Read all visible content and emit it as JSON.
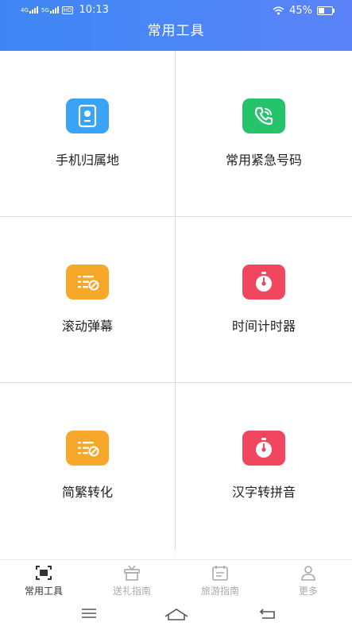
{
  "status_bar": {
    "network_1": "4G",
    "network_2": "5G",
    "hd_badge": "HD",
    "time": "10:13",
    "wifi_icon": "wifi-icon",
    "battery_percent": "45%",
    "battery_level": 0.45
  },
  "header": {
    "title": "常用工具"
  },
  "tools": [
    {
      "label": "手机归属地",
      "icon": "phone-location-icon",
      "color": "#3aa3f5"
    },
    {
      "label": "常用紧急号码",
      "icon": "phone-call-icon",
      "color": "#25c46a"
    },
    {
      "label": "滚动弹幕",
      "icon": "barrage-icon",
      "color": "#f7a72a"
    },
    {
      "label": "时间计时器",
      "icon": "stopwatch-icon",
      "color": "#f0475e"
    },
    {
      "label": "简繁转化",
      "icon": "convert-icon",
      "color": "#f7a72a"
    },
    {
      "label": "汉字转拼音",
      "icon": "stopwatch-icon",
      "color": "#f0475e"
    }
  ],
  "tabbar": {
    "items": [
      {
        "label": "常用工具",
        "icon": "tools-scan-icon",
        "active": true
      },
      {
        "label": "送礼指南",
        "icon": "gift-icon",
        "active": false
      },
      {
        "label": "旅游指南",
        "icon": "calendar-icon",
        "active": false
      },
      {
        "label": "更多",
        "icon": "person-icon",
        "active": false
      }
    ]
  },
  "system_nav": {
    "menu_icon": "menu-icon",
    "home_icon": "home-icon",
    "back_icon": "back-icon"
  }
}
